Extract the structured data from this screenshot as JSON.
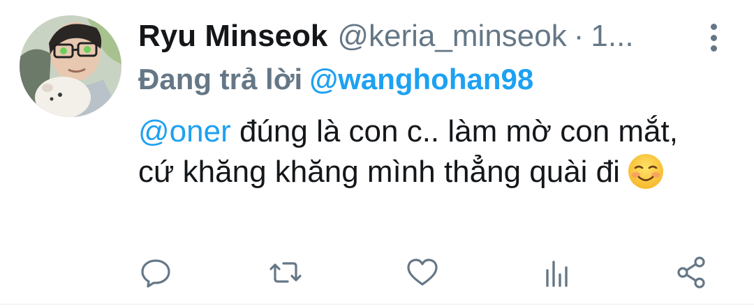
{
  "tweet": {
    "display_name": "Ryu Minseok",
    "username": "@keria_minseok",
    "separator": "·",
    "time": "1...",
    "reply_prefix": "Đang trả lời",
    "reply_to": "@wanghohan98",
    "mention": "@oner",
    "text": " đúng là con c.. làm mờ con mắt, cứ khăng khăng mình thẳng quài đi",
    "emoji": "smiling-face-icon"
  },
  "actions": {
    "reply": "reply-icon",
    "retweet": "retweet-icon",
    "like": "heart-icon",
    "analytics": "analytics-icon",
    "share": "share-icon"
  },
  "colors": {
    "accent": "#1da1f2",
    "secondary_text": "#657786",
    "primary_text": "#14171a"
  }
}
